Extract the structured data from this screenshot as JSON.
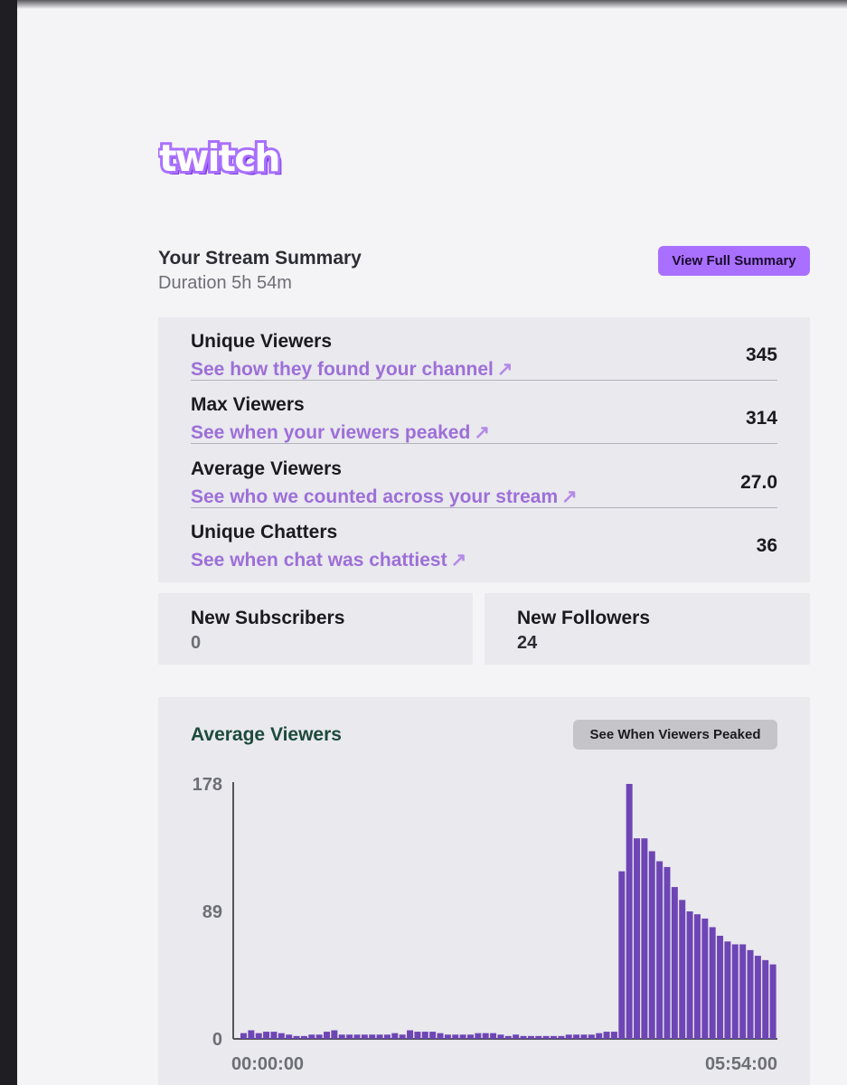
{
  "header": {
    "logo_text": "twitch",
    "title": "Your Stream Summary",
    "duration": "Duration 5h 54m",
    "full_summary_button": "View Full Summary"
  },
  "stats": [
    {
      "label": "Unique Viewers",
      "link": "See how they found your channel",
      "value": "345"
    },
    {
      "label": "Max Viewers",
      "link": "See when your viewers peaked",
      "value": "314"
    },
    {
      "label": "Average Viewers",
      "link": "See who we counted across your stream",
      "value": "27.0"
    },
    {
      "label": "Unique Chatters",
      "link": "See when chat was chattiest",
      "value": "36"
    }
  ],
  "link_arrow": "↗",
  "cards": [
    {
      "label": "New Subscribers",
      "value": "0"
    },
    {
      "label": "New Followers",
      "value": "24"
    }
  ],
  "chart_section": {
    "title": "Average Viewers",
    "button": "See When Viewers Peaked"
  },
  "colors": {
    "accent": "#a970ff",
    "link": "#9d6fd8",
    "bar": "#6e45b5",
    "chart_title": "#1d4a3b"
  },
  "chart_data": {
    "type": "bar",
    "title": "Average Viewers",
    "y_ticks": [
      "178",
      "89",
      "0"
    ],
    "ylim": [
      0,
      178
    ],
    "x_tick_labels": [
      "00:00:00",
      "05:54:00"
    ],
    "values": [
      4,
      6,
      4,
      5,
      5,
      4,
      3,
      2,
      2,
      3,
      3,
      5,
      6,
      3,
      3,
      3,
      3,
      3,
      3,
      3,
      4,
      3,
      6,
      5,
      5,
      5,
      4,
      3,
      3,
      3,
      3,
      4,
      4,
      4,
      3,
      2,
      3,
      2,
      2,
      2,
      2,
      2,
      2,
      3,
      3,
      3,
      3,
      4,
      5,
      5,
      117,
      178,
      140,
      140,
      131,
      124,
      120,
      106,
      97,
      89,
      87,
      84,
      78,
      72,
      68,
      66,
      66,
      62,
      58,
      55,
      52
    ]
  }
}
